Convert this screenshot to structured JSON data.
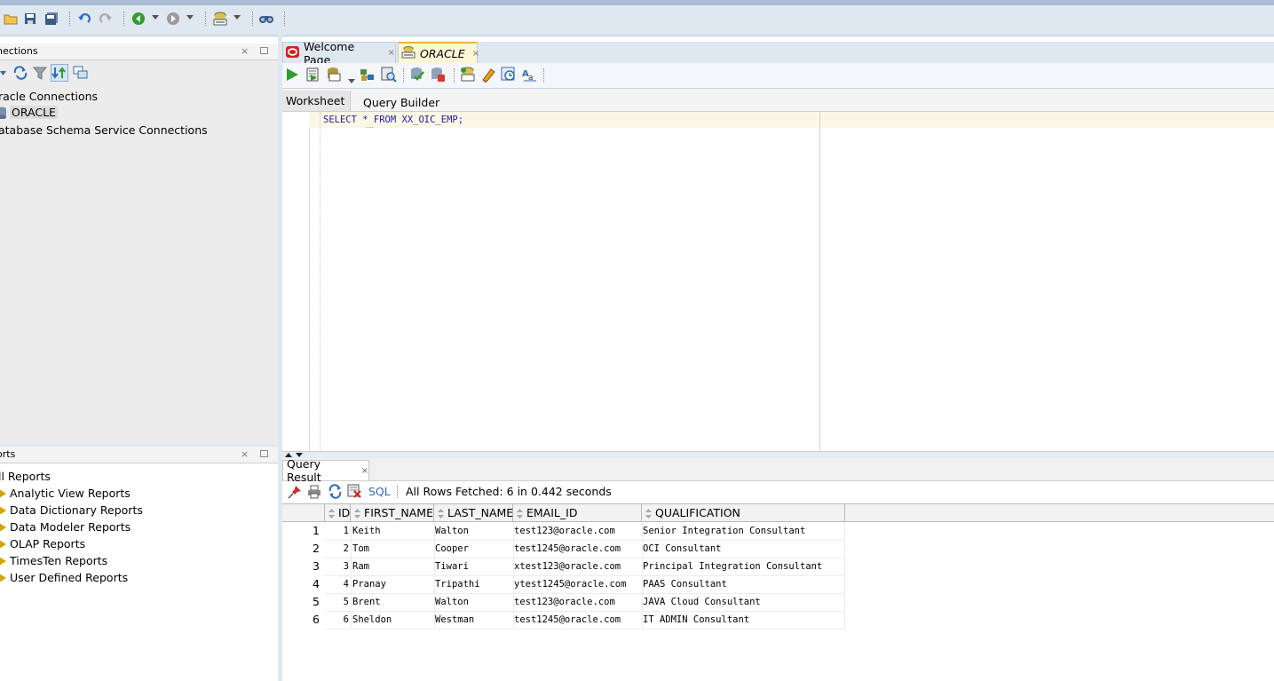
{
  "toolbar": {
    "icons": [
      "open-icon",
      "save-icon",
      "save-all-icon",
      "undo-icon",
      "redo-icon",
      "back-icon",
      "forward-icon",
      "sql-worksheet-icon",
      "find-db-object-icon"
    ]
  },
  "connections_panel": {
    "title": "nections",
    "close_glyph": "×",
    "items": [
      {
        "label": "racle Connections"
      },
      {
        "label": "ORACLE"
      },
      {
        "label": "atabase Schema Service Connections"
      }
    ]
  },
  "reports_panel": {
    "title": "orts",
    "close_glyph": "×",
    "items": [
      {
        "label": "ll Reports"
      },
      {
        "label": "Analytic View Reports"
      },
      {
        "label": "Data Dictionary Reports"
      },
      {
        "label": "Data Modeler Reports"
      },
      {
        "label": "OLAP Reports"
      },
      {
        "label": "TimesTen Reports"
      },
      {
        "label": "User Defined Reports"
      }
    ]
  },
  "editor_tabs": [
    {
      "label": "Welcome Page",
      "close": "×"
    },
    {
      "label": "ORACLE",
      "close": "×"
    }
  ],
  "worksheet_tabs": [
    {
      "label": "Worksheet"
    },
    {
      "label": "Query Builder"
    }
  ],
  "editor": {
    "sql": "SELECT * FROM XX_OIC_EMP;"
  },
  "result": {
    "tab_label": "Query Result",
    "tab_close": "×",
    "sql_link": "SQL",
    "status": "All Rows Fetched: 6 in 0.442 seconds",
    "columns": [
      "ID",
      "FIRST_NAME",
      "LAST_NAME",
      "EMAIL_ID",
      "QUALIFICATION"
    ],
    "rows": [
      {
        "n": "1",
        "id": "1",
        "first": "Keith",
        "last": "Walton",
        "email": "test123@oracle.com",
        "qual": "Senior Integration Consultant"
      },
      {
        "n": "2",
        "id": "2",
        "first": "Tom",
        "last": "Cooper",
        "email": "test1245@oracle.com",
        "qual": "OCI Consultant"
      },
      {
        "n": "3",
        "id": "3",
        "first": "Ram",
        "last": "Tiwari",
        "email": "xtest123@oracle.com",
        "qual": "Principal Integration Consultant"
      },
      {
        "n": "4",
        "id": "4",
        "first": "Pranay",
        "last": "Tripathi",
        "email": "ytest1245@oracle.com",
        "qual": "PAAS Consultant"
      },
      {
        "n": "5",
        "id": "5",
        "first": "Brent",
        "last": "Walton",
        "email": "test123@oracle.com",
        "qual": "JAVA Cloud Consultant"
      },
      {
        "n": "6",
        "id": "6",
        "first": "Sheldon",
        "last": "Westman",
        "email": "test1245@oracle.com",
        "qual": "IT ADMIN Consultant"
      }
    ]
  },
  "colors": {
    "accent_blue": "#2f6db5",
    "run_green": "#2e9e2e",
    "sql_blue": "#1d1da8",
    "tree_arrow": "#d6a300"
  }
}
